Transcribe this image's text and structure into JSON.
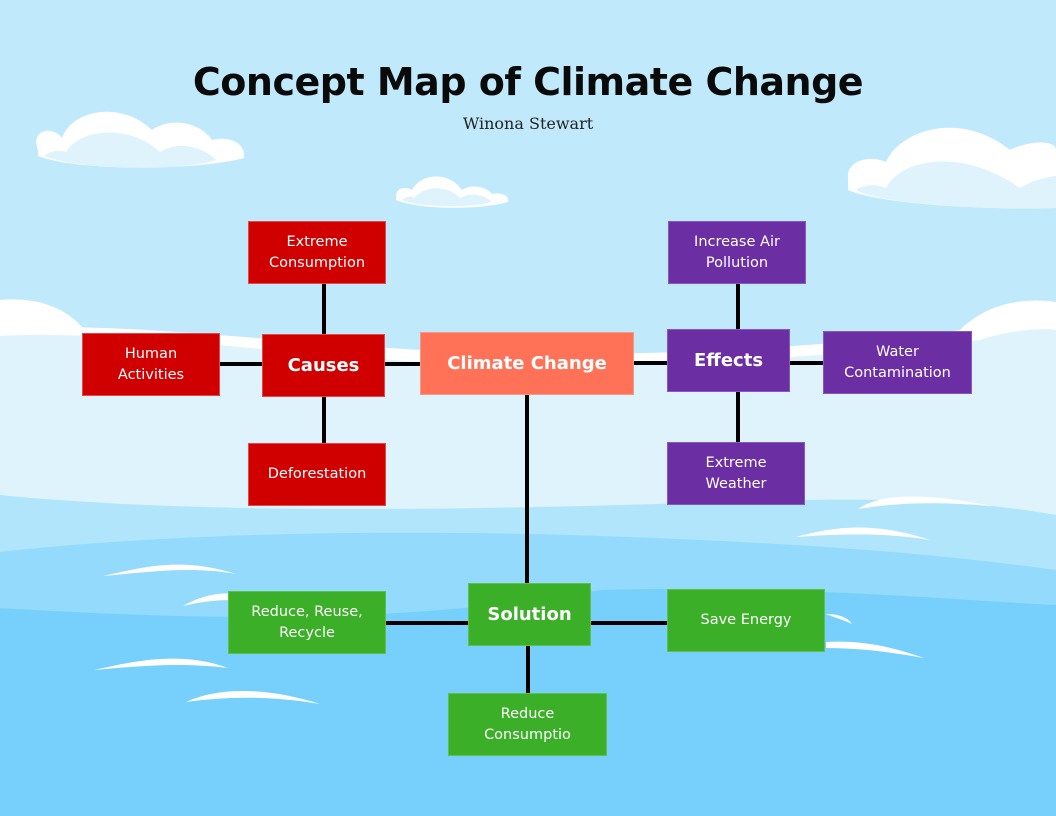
{
  "header": {
    "title": "Concept Map of Climate Change",
    "author": "Winona Stewart"
  },
  "colors": {
    "sky": "#c1e9fc",
    "causes": "#d10000",
    "effects": "#6b2ea3",
    "solution": "#3aaf27",
    "central": "#ff7258",
    "connector": "#000000"
  },
  "central": {
    "label": "Climate Change"
  },
  "causes": {
    "label": "Causes",
    "items": [
      {
        "label": "Extreme\nConsumption"
      },
      {
        "label": "Human\nActivities"
      },
      {
        "label": "Deforestation"
      }
    ]
  },
  "effects": {
    "label": "Effects",
    "items": [
      {
        "label": "Increase Air\nPollution"
      },
      {
        "label": "Water\nContamination"
      },
      {
        "label": "Extreme\nWeather"
      }
    ]
  },
  "solution": {
    "label": "Solution",
    "items": [
      {
        "label": "Reduce, Reuse,\nRecycle"
      },
      {
        "label": "Save Energy"
      },
      {
        "label": "Reduce\nConsumptio"
      }
    ]
  }
}
